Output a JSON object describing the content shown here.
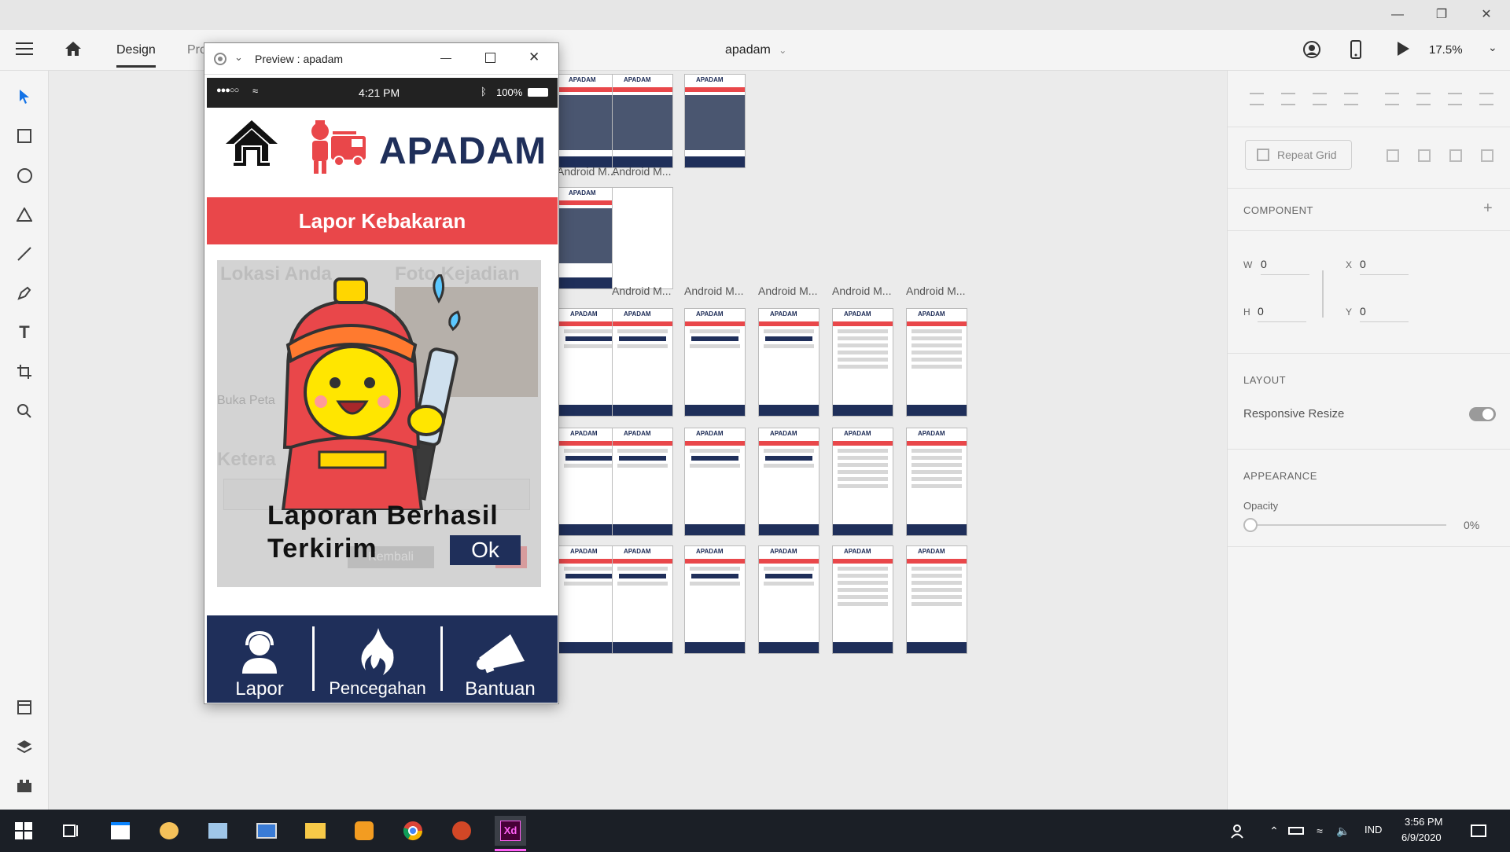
{
  "app": {
    "menu_icon": "hamburger-icon",
    "home_icon": "home-icon",
    "tabs": [
      "Design",
      "Prototype"
    ],
    "document_title": "apadam",
    "zoom": "17.5%"
  },
  "preview_window": {
    "title": "Preview : apadam"
  },
  "phone": {
    "signal": "●●●○○",
    "time": "4:21 PM",
    "battery": "100%",
    "brand": "APADAM",
    "banner": "Lapor Kebakaran",
    "bg_labels": [
      "Lokasi Anda",
      "Foto Kejadian",
      "Buka Peta",
      "Ketera",
      "Kembali"
    ],
    "dialog_message_line1": "Laporan Berhasil",
    "dialog_message_line2": "Terkirim",
    "ok_button": "Ok",
    "nav": [
      "Lapor",
      "Pencegahan",
      "Bantuan"
    ]
  },
  "canvas": {
    "artboard_label": "Android M...",
    "mini_brand": "APADAM"
  },
  "right_panel": {
    "repeat_grid": "Repeat Grid",
    "component_title": "COMPONENT",
    "w_label": "W",
    "w_value": "0",
    "h_label": "H",
    "h_value": "0",
    "x_label": "X",
    "x_value": "0",
    "y_label": "Y",
    "y_value": "0",
    "layout_title": "LAYOUT",
    "responsive_resize": "Responsive Resize",
    "appearance_title": "APPEARANCE",
    "opacity_label": "Opacity",
    "opacity_value": "0%"
  },
  "taskbar": {
    "language": "IND",
    "time": "3:56 PM",
    "date": "6/9/2020"
  },
  "colors": {
    "brand_navy": "#1f2f5a",
    "brand_red": "#e9474a",
    "accent_blue": "#1473e6"
  }
}
